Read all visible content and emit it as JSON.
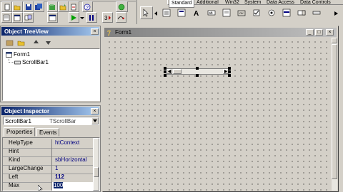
{
  "palette": {
    "tabs": [
      "Standard",
      "Additional",
      "Win32",
      "System",
      "Data Access",
      "Data Controls"
    ]
  },
  "toolbar": {
    "icons": [
      "new-icon",
      "open-icon",
      "save-icon",
      "save-all-icon",
      "open-project-icon",
      "add-file-icon",
      "remove-file-icon",
      "toggle-form-unit-icon",
      "view-unit-icon",
      "view-form-icon",
      "run-icon",
      "pause-icon",
      "step-into-icon",
      "step-over-icon",
      "help-icon"
    ]
  },
  "tree_view": {
    "title": "Object TreeView",
    "nodes": [
      {
        "label": "Form1",
        "level": 0
      },
      {
        "label": "ScrollBar1",
        "level": 1
      }
    ]
  },
  "inspector": {
    "title": "Object Inspector",
    "selector_name": "ScrollBar1",
    "selector_type": "TScrollBar",
    "tabs": [
      "Properties",
      "Events"
    ],
    "rows": [
      {
        "name": "HelpType",
        "value": "htContext",
        "bold": false
      },
      {
        "name": "Hint",
        "value": "",
        "bold": false
      },
      {
        "name": "Kind",
        "value": "sbHorizontal",
        "bold": false
      },
      {
        "name": "LargeChange",
        "value": "1",
        "bold": false
      },
      {
        "name": "Left",
        "value": "112",
        "bold": true
      },
      {
        "name": "Max",
        "value": "100",
        "bold": false,
        "editing": true
      }
    ]
  },
  "form": {
    "title": "Form1"
  },
  "colors": {
    "active_title": "#0a246a",
    "active_title_end": "#a6caf0",
    "face": "#d4d0c8",
    "value_text": "#000080"
  }
}
